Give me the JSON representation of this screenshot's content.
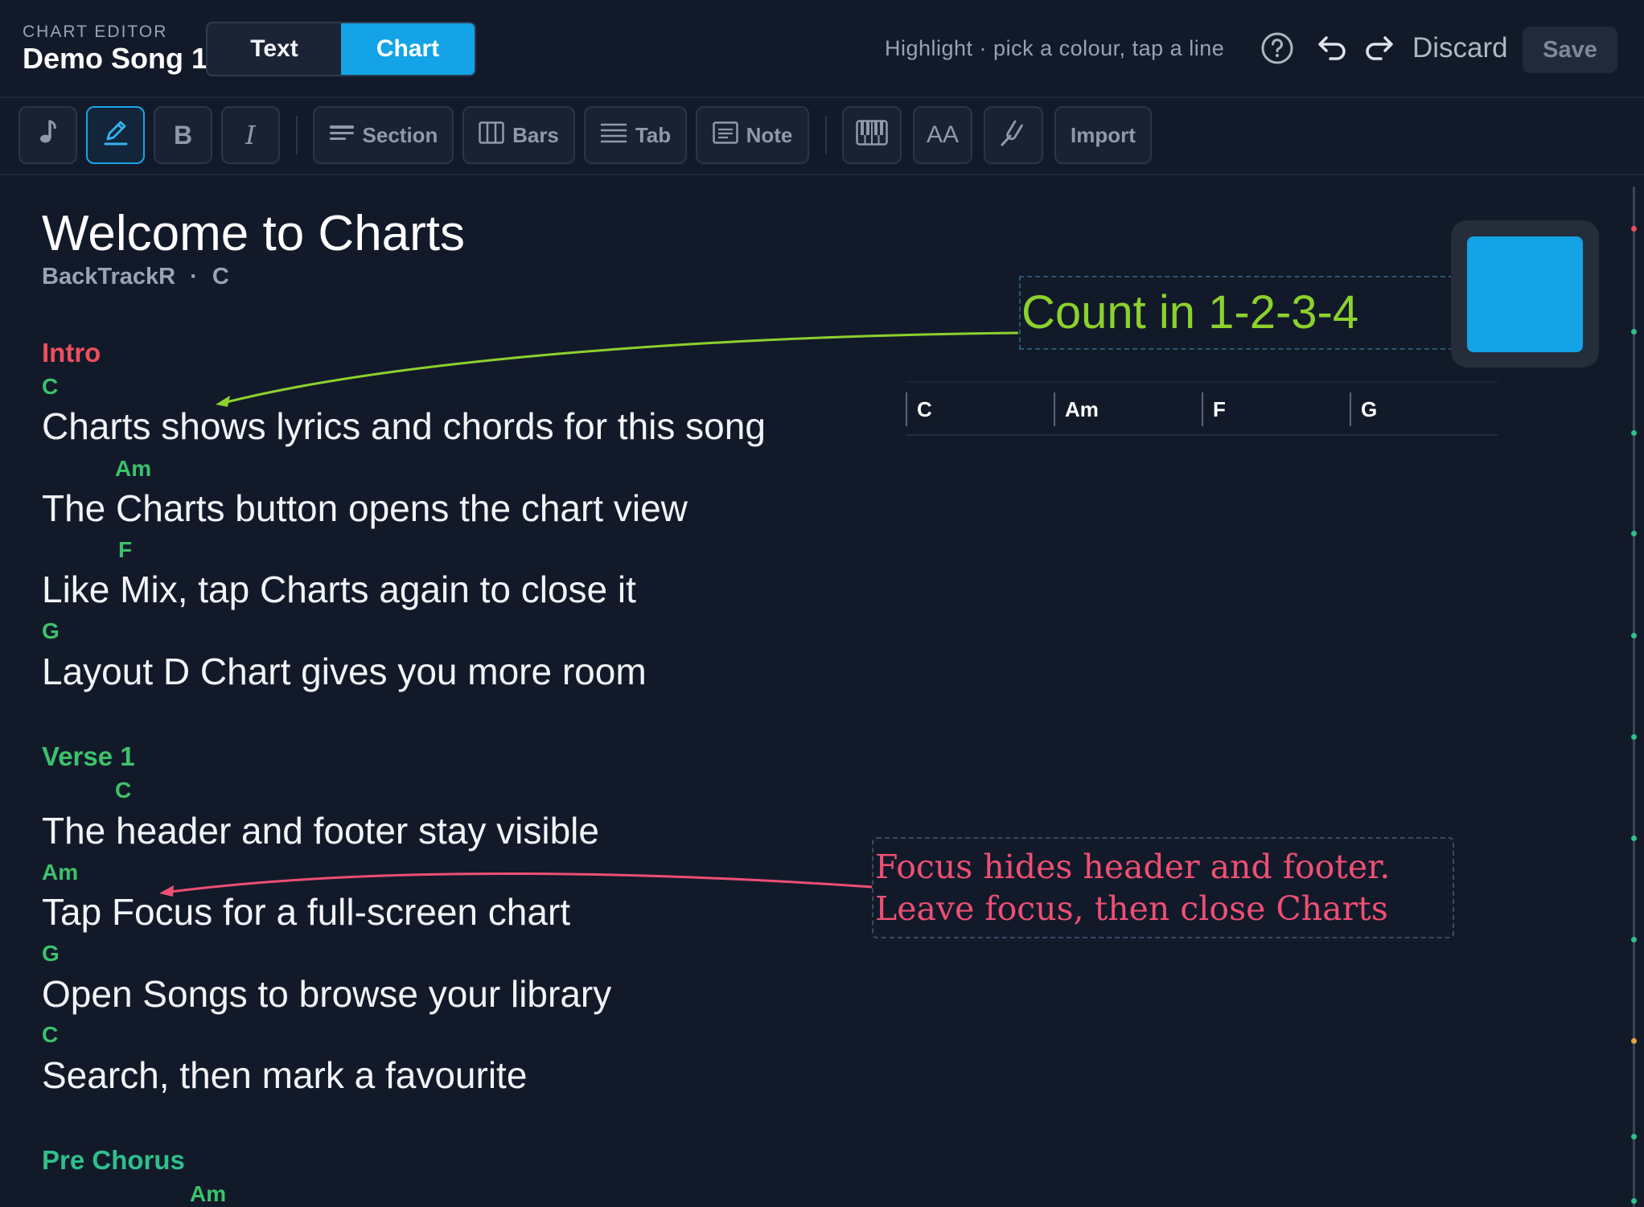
{
  "header": {
    "eyebrow": "CHART EDITOR",
    "song_title": "Demo Song 1",
    "segments": [
      {
        "label": "Text",
        "active": false
      },
      {
        "label": "Chart",
        "active": true
      }
    ],
    "hint": "Highlight · pick a colour, tap a line",
    "icons": [
      "help-icon",
      "undo-icon",
      "redo-icon"
    ],
    "discard_label": "Discard",
    "save_label": "Save"
  },
  "toolbar": {
    "icon_buttons_left": [
      "music-note-icon",
      "pen-icon",
      "bold-icon",
      "italic-icon"
    ],
    "bold_glyph": "B",
    "italic_glyph": "I",
    "section_label": "Section",
    "bars_label": "Bars",
    "tab_label": "Tab",
    "note_label": "Note",
    "font_size_glyph": "AA",
    "icon_buttons_right": [
      "piano-icon",
      "font-size-icon",
      "tuning-fork-icon"
    ],
    "import_label": "Import"
  },
  "document": {
    "title": "Welcome to Charts",
    "artist": "BackTrackR",
    "separator": "·",
    "key": "C",
    "sections": [
      {
        "name": "Intro",
        "color": "#ef4f5b",
        "lines": [
          {
            "chord": "C",
            "lyric": "Charts shows lyrics and chords for this song"
          },
          {
            "chord": "Am",
            "lyric": "The Charts button opens the chart view"
          },
          {
            "chord": "F",
            "lyric": "Like Mix, tap Charts again to close it"
          },
          {
            "chord": "G",
            "lyric": "Layout D Chart gives you more room"
          }
        ]
      },
      {
        "name": "Verse 1",
        "color": "#3cc26a",
        "lines": [
          {
            "chord": "C",
            "lyric": "The header and footer stay visible"
          },
          {
            "chord": "Am",
            "lyric": "Tap Focus for a full-screen chart"
          },
          {
            "chord": "G",
            "lyric": "Open Songs to browse your library"
          },
          {
            "chord": "C",
            "lyric": "Search, then mark a favourite"
          }
        ]
      },
      {
        "name": "Pre Chorus",
        "color": "#2fbf8a",
        "lines": [
          {
            "chord": "Am",
            "lyric": ""
          }
        ]
      }
    ]
  },
  "annotations": {
    "count_in": {
      "text": "Count in 1-2-3-4",
      "color": "#8dd12d"
    },
    "focus_note": {
      "text": "Focus hides header and footer. Leave focus, then close Charts",
      "color": "#ef4f73"
    }
  },
  "highlight_swatch_color": "#13a3e6",
  "bar_row": [
    "C",
    "Am",
    "F",
    "G"
  ],
  "scroll_markers": [
    "#ef4f5b",
    "#2fbf8a",
    "#2fbf8a",
    "#2fbf8a",
    "#2fbf8a",
    "#2fbf8a",
    "#2fbf8a",
    "#2fbf8a",
    "#e8a33a",
    "#2fbf8a",
    "#2fbf8a"
  ]
}
